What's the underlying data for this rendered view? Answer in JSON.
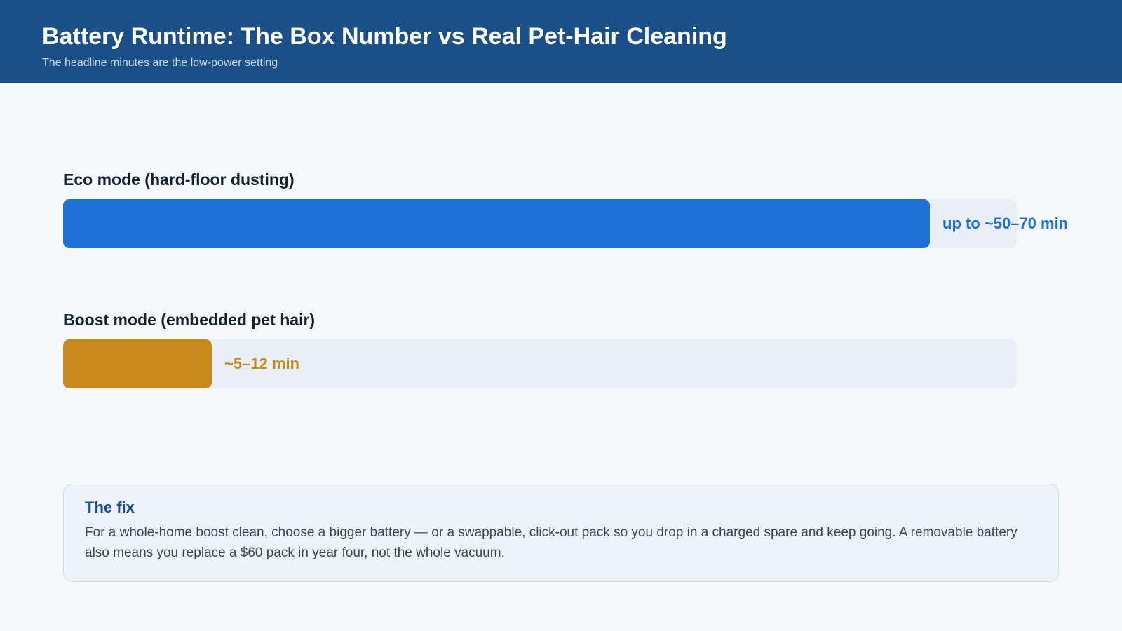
{
  "header": {
    "title": "Battery Runtime: The Box Number vs Real Pet-Hair Cleaning",
    "subtitle": "The headline minutes are the low-power setting"
  },
  "chart_data": {
    "type": "bar",
    "orientation": "horizontal",
    "categories": [
      "Eco mode (hard-floor dusting)",
      "Boost mode (embedded pet hair)"
    ],
    "values": [
      70,
      12
    ],
    "value_labels": [
      "up to ~50–70 min",
      "~5–12 min"
    ],
    "colors": [
      "#1e6fd6",
      "#c8891d"
    ],
    "xlim": [
      0,
      77
    ],
    "grid": false
  },
  "fix": {
    "title": "The fix",
    "body": "For a whole-home boost clean, choose a bigger battery — or a swappable, click-out pack so you drop in a charged spare and keep going. A removable battery also means you replace a $60 pack in year four, not the whole vacuum."
  }
}
